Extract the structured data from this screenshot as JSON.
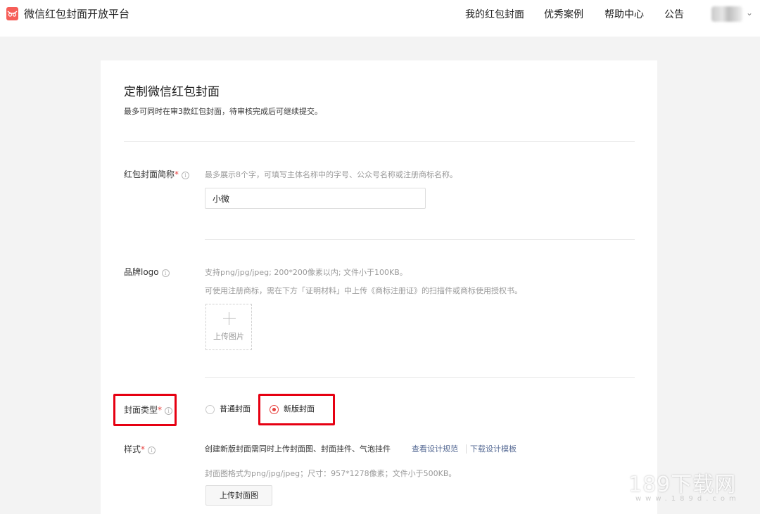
{
  "header": {
    "brand": "微信红包封面开放平台",
    "nav": [
      "我的红包封面",
      "优秀案例",
      "帮助中心",
      "公告"
    ]
  },
  "form": {
    "title": "定制微信红包封面",
    "subtitle": "最多可同时在审3款红包封面，待审核完成后可继续提交。",
    "name_field": {
      "label": "红包封面简称",
      "hint": "最多展示8个字，可填写主体名称中的字号、公众号名称或注册商标名称。",
      "value": "小微"
    },
    "logo_field": {
      "label": "品牌logo",
      "hint1": "支持png/jpg/jpeg; 200*200像素以内; 文件小于100KB。",
      "hint2": "可使用注册商标，需在下方「证明材料」中上传《商标注册证》的扫描件或商标使用授权书。",
      "upload_label": "上传图片"
    },
    "cover_type": {
      "label": "封面类型",
      "options": [
        "普通封面",
        "新版封面"
      ],
      "selected": "新版封面"
    },
    "style_field": {
      "label": "样式",
      "desc": "创建新版封面需同时上传封面图、封面挂件、气泡挂件",
      "link1": "查看设计规范",
      "link2": "下载设计模板",
      "hint": "封面图格式为png/jpg/jpeg；尺寸：957*1278像素；文件小于500KB。",
      "upload_button": "上传封面图"
    }
  },
  "watermark": {
    "main": "189下载网",
    "sub": "www.189d.com"
  },
  "colors": {
    "accent": "#e64340",
    "link": "#576b95",
    "highlight": "#e60012"
  }
}
